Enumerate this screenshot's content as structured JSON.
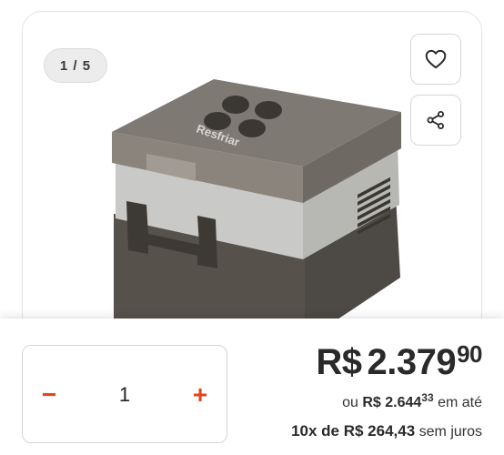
{
  "gallery": {
    "counter": "1 / 5",
    "favorite_icon": "heart-icon",
    "share_icon": "share-icon",
    "image": {
      "subject": "portable compressor fridge",
      "brand_text": "Resfriar",
      "colors": {
        "lid": "#7c766f",
        "upper_body": "#c8c8c6",
        "lower_body": "#4d4944"
      }
    }
  },
  "quantity": {
    "minus_label": "−",
    "value": "1",
    "plus_label": "+",
    "accent_color": "#e2451b"
  },
  "price": {
    "currency": "R$",
    "integer": "2.379",
    "cents": "90",
    "full_prefix": "ou",
    "full_currency_int": "R$ 2.644",
    "full_cents": "33",
    "full_suffix": "em até",
    "installments": "10x de R$ 264,43",
    "installments_suffix": "sem juros"
  }
}
